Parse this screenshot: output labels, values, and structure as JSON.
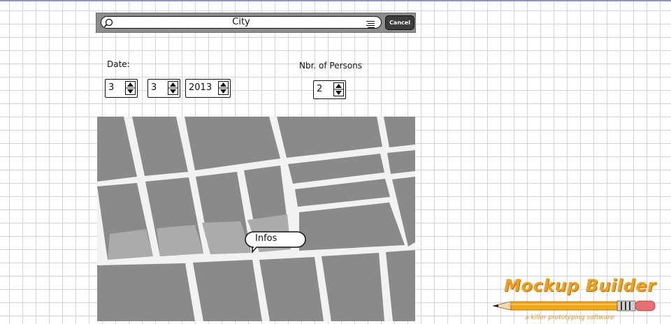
{
  "search": {
    "placeholder": "City",
    "cancel_label": "Cancel"
  },
  "date": {
    "label": "Date:",
    "day": "3",
    "month": "3",
    "year": "2013"
  },
  "persons": {
    "label": "Nbr. of Persons",
    "value": "2"
  },
  "map": {
    "tooltip": "Infos"
  },
  "logo": {
    "title": "Mockup Builder",
    "subtitle": "a killer prototyping software"
  },
  "colors": {
    "map_block": "#8a8a8a",
    "map_highlight": "#aaaaaa",
    "road": "#f2f2f2",
    "accent": "#f0a020"
  }
}
